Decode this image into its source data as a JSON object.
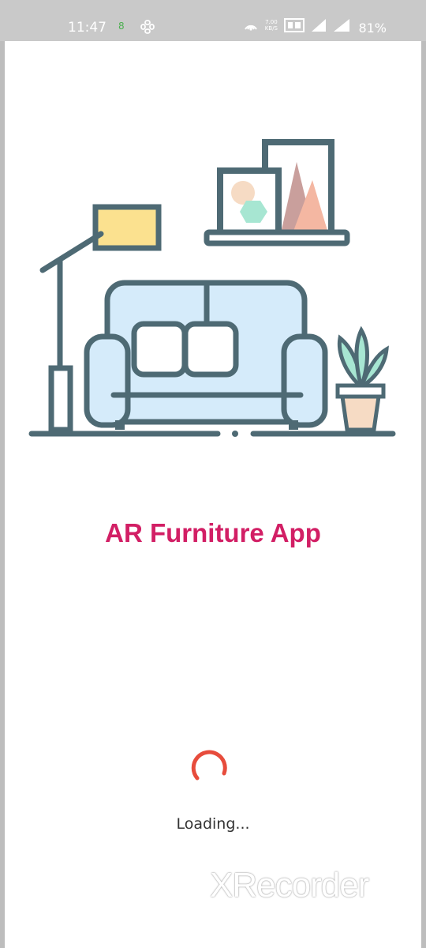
{
  "status_bar": {
    "time": "11:47",
    "notification_badge": "8",
    "network_speed": "7.00",
    "network_speed_unit": "KB/S",
    "battery": "81%"
  },
  "app": {
    "title": "AR Furniture App",
    "title_color": "#d21f65",
    "illustration": "living-room-sofa-illustration"
  },
  "loading": {
    "text": "Loading...",
    "spinner_color": "#e74c3c"
  },
  "watermark": {
    "text": "XRecorder"
  }
}
